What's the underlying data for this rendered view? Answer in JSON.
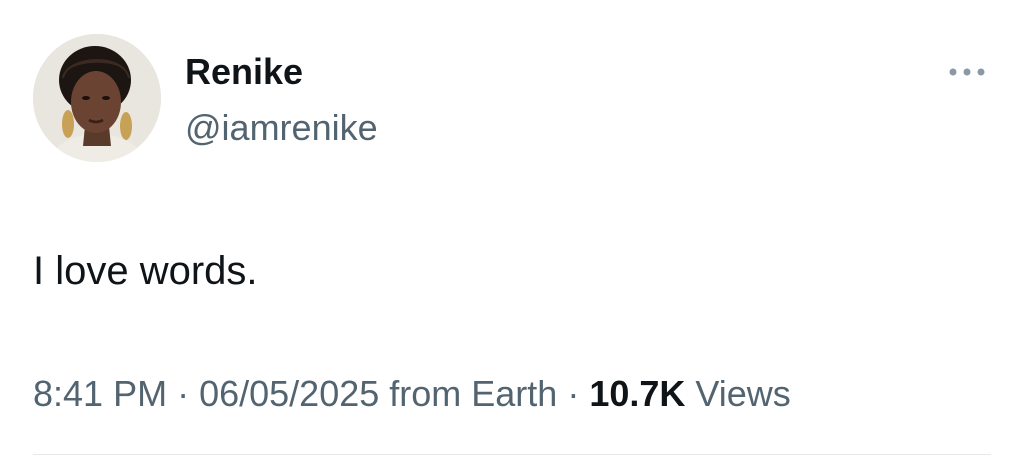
{
  "author": {
    "name": "Renike",
    "handle": "@iamrenike",
    "avatar_icon": "profile-photo"
  },
  "menu": {
    "icon": "more-horizontal-icon"
  },
  "tweet": {
    "text": "I love words."
  },
  "meta": {
    "time": "8:41 PM",
    "separator_1": " · ",
    "date": "06/05/2025",
    "source": " from Earth",
    "separator_2": " · ",
    "views_count": "10.7K",
    "views_label": " Views"
  },
  "colors": {
    "primary_text": "#0f1419",
    "secondary_text": "#536471",
    "divider": "#e6e8ea"
  }
}
